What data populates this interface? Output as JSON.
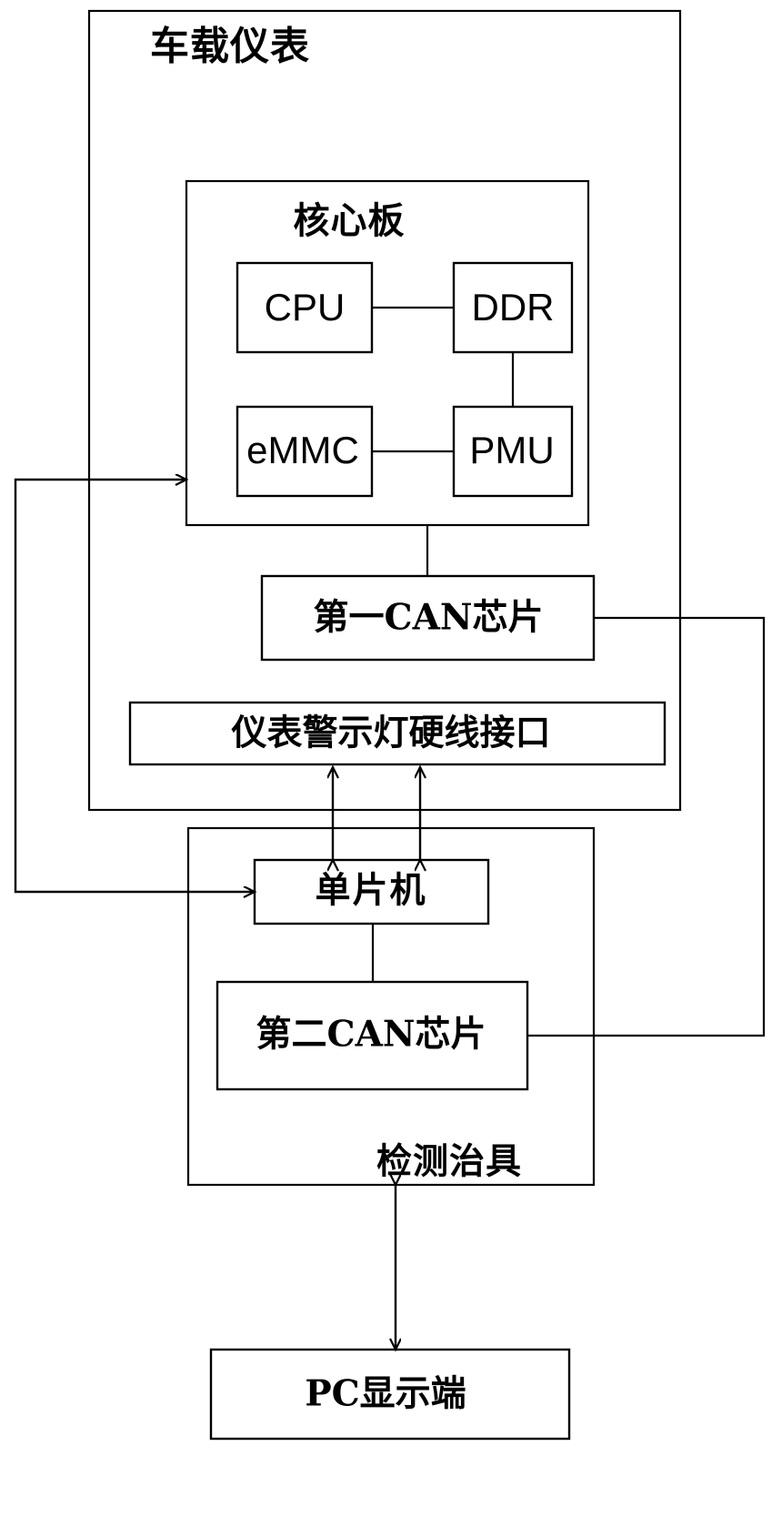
{
  "diagram": {
    "title": "车载仪表",
    "nodes": {
      "vehicle_instrument": {
        "label": "车载仪表",
        "role": "outer-container"
      },
      "core_board": {
        "label": "核心板",
        "role": "container"
      },
      "cpu": {
        "label": "CPU",
        "role": "component"
      },
      "ddr": {
        "label": "DDR",
        "role": "component"
      },
      "emmc": {
        "label": "eMMC",
        "role": "component"
      },
      "pmu": {
        "label": "PMU",
        "role": "component"
      },
      "first_can_chip": {
        "label": "第一CAN芯片",
        "role": "component"
      },
      "warning_light_interface": {
        "label": "仪表警示灯硬线接口",
        "role": "component"
      },
      "test_fixture": {
        "label": "检测治具",
        "role": "outer-container"
      },
      "mcu": {
        "label": "单片机",
        "role": "component"
      },
      "second_can_chip": {
        "label": "第二CAN芯片",
        "role": "component"
      },
      "pc_display": {
        "label": "PC显示端",
        "role": "component"
      }
    },
    "connections": [
      {
        "from": "cpu",
        "to": "ddr",
        "style": "plain"
      },
      {
        "from": "ddr",
        "to": "pmu",
        "style": "plain"
      },
      {
        "from": "emmc",
        "to": "pmu",
        "style": "plain"
      },
      {
        "from": "core_board",
        "to": "first_can_chip",
        "style": "plain"
      },
      {
        "from": "first_can_chip",
        "to": "second_can_chip",
        "style": "plain-routed-right"
      },
      {
        "from": "warning_light_interface",
        "to": "mcu",
        "style": "double-arrow"
      },
      {
        "from": "mcu",
        "to": "second_can_chip",
        "style": "plain"
      },
      {
        "from": "second_can_chip",
        "to": "core_board",
        "style": "arrow-routed-left"
      },
      {
        "from": "first_can_chip",
        "to": "mcu",
        "style": "arrow-routed-left"
      },
      {
        "from": "test_fixture",
        "to": "pc_display",
        "style": "double-arrow"
      }
    ],
    "colors": {
      "stroke": "#000000",
      "background": "#ffffff",
      "text": "#000000"
    }
  }
}
